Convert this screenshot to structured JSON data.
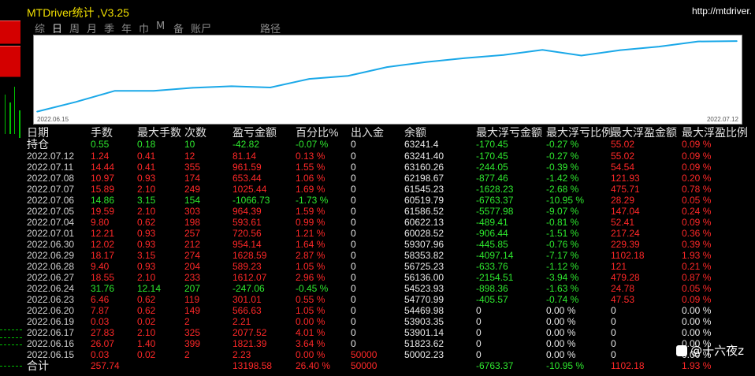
{
  "colors": {
    "red": "#ff2828",
    "green": "#2ee82e",
    "white": "#e8e8e8",
    "yellow": "#f2e000",
    "line": "#1aa8e8"
  },
  "window": {
    "title": "MTDriver统计 ,V3.25",
    "url": "http://mtdriver."
  },
  "tabs": [
    {
      "label": "综",
      "active": false
    },
    {
      "label": "日",
      "active": true
    },
    {
      "label": "周",
      "active": false
    },
    {
      "label": "月",
      "active": false
    },
    {
      "label": "季",
      "active": false
    },
    {
      "label": "年",
      "active": false
    },
    {
      "label": "巾",
      "active": false
    },
    {
      "label": "M",
      "active": false
    },
    {
      "label": "备",
      "active": false
    },
    {
      "label": "账尸",
      "active": false
    },
    {
      "label": "路径",
      "active": false
    }
  ],
  "chart_data": {
    "type": "line",
    "x_start": "2022.06.15",
    "x_end": "2022.07.12",
    "x": [
      "2022.06.15",
      "2022.06.16",
      "2022.06.17",
      "2022.06.19",
      "2022.06.20",
      "2022.06.23",
      "2022.06.24",
      "2022.06.27",
      "2022.06.28",
      "2022.06.29",
      "2022.06.30",
      "2022.07.01",
      "2022.07.04",
      "2022.07.05",
      "2022.07.06",
      "2022.07.07",
      "2022.07.08",
      "2022.07.11",
      "2022.07.12"
    ],
    "values": [
      50002.23,
      51823.62,
      53901.14,
      53903.35,
      54469.98,
      54770.99,
      54523.93,
      56136.0,
      56725.23,
      58353.82,
      59307.96,
      60028.52,
      60622.13,
      61586.52,
      60519.79,
      61545.23,
      62198.67,
      63160.26,
      63241.4
    ],
    "ylim": [
      49500,
      63700
    ]
  },
  "table": {
    "headers": [
      "日期",
      "手数",
      "最大手数",
      "次数",
      "盈亏金额",
      "百分比%",
      "出入金",
      "余额",
      "最大浮亏金额",
      "最大浮亏比例",
      "最大浮盈金额",
      "最大浮盈比例"
    ],
    "rows": [
      {
        "cells": [
          "持仓",
          "0.55",
          "0.18",
          "10",
          "-42.82",
          "-0.07 %",
          "0",
          "63241.4",
          "-170.45",
          "-0.27 %",
          "55.02",
          "0.09 %"
        ],
        "tone": "green",
        "first_tone": "white"
      },
      {
        "cells": [
          "2022.07.12",
          "1.24",
          "0.41",
          "12",
          "81.14",
          "0.13 %",
          "0",
          "63241.40",
          "-170.45",
          "-0.27 %",
          "55.02",
          "0.09 %"
        ],
        "tone": "red"
      },
      {
        "cells": [
          "2022.07.11",
          "14.44",
          "0.41",
          "355",
          "961.59",
          "1.55 %",
          "0",
          "63160.26",
          "-244.05",
          "-0.39 %",
          "54.54",
          "0.09 %"
        ],
        "tone": "red"
      },
      {
        "cells": [
          "2022.07.08",
          "10.97",
          "0.93",
          "174",
          "653.44",
          "1.06 %",
          "0",
          "62198.67",
          "-877.46",
          "-1.42 %",
          "121.93",
          "0.20 %"
        ],
        "tone": "red"
      },
      {
        "cells": [
          "2022.07.07",
          "15.89",
          "2.10",
          "249",
          "1025.44",
          "1.69 %",
          "0",
          "61545.23",
          "-1628.23",
          "-2.68 %",
          "475.71",
          "0.78 %"
        ],
        "tone": "red"
      },
      {
        "cells": [
          "2022.07.06",
          "14.86",
          "3.15",
          "154",
          "-1066.73",
          "-1.73 %",
          "0",
          "60519.79",
          "-6763.37",
          "-10.95 %",
          "28.29",
          "0.05 %"
        ],
        "tone": "green"
      },
      {
        "cells": [
          "2022.07.05",
          "19.59",
          "2.10",
          "303",
          "964.39",
          "1.59 %",
          "0",
          "61586.52",
          "-5577.98",
          "-9.07 %",
          "147.04",
          "0.24 %"
        ],
        "tone": "red"
      },
      {
        "cells": [
          "2022.07.04",
          "9.80",
          "0.62",
          "198",
          "593.61",
          "0.99 %",
          "0",
          "60622.13",
          "-489.41",
          "-0.81 %",
          "52.41",
          "0.09 %"
        ],
        "tone": "red"
      },
      {
        "cells": [
          "2022.07.01",
          "12.21",
          "0.93",
          "257",
          "720.56",
          "1.21 %",
          "0",
          "60028.52",
          "-906.44",
          "-1.51 %",
          "217.24",
          "0.36 %"
        ],
        "tone": "red"
      },
      {
        "cells": [
          "2022.06.30",
          "12.02",
          "0.93",
          "212",
          "954.14",
          "1.64 %",
          "0",
          "59307.96",
          "-445.85",
          "-0.76 %",
          "229.39",
          "0.39 %"
        ],
        "tone": "red"
      },
      {
        "cells": [
          "2022.06.29",
          "18.17",
          "3.15",
          "274",
          "1628.59",
          "2.87 %",
          "0",
          "58353.82",
          "-4097.14",
          "-7.17 %",
          "1102.18",
          "1.93 %"
        ],
        "tone": "red"
      },
      {
        "cells": [
          "2022.06.28",
          "9.40",
          "0.93",
          "204",
          "589.23",
          "1.05 %",
          "0",
          "56725.23",
          "-633.76",
          "-1.12 %",
          "121",
          "0.21 %"
        ],
        "tone": "red"
      },
      {
        "cells": [
          "2022.06.27",
          "18.55",
          "2.10",
          "233",
          "1612.07",
          "2.96 %",
          "0",
          "56136.00",
          "-2154.51",
          "-3.94 %",
          "479.28",
          "0.87 %"
        ],
        "tone": "red"
      },
      {
        "cells": [
          "2022.06.24",
          "31.76",
          "12.14",
          "207",
          "-247.06",
          "-0.45 %",
          "0",
          "54523.93",
          "-898.36",
          "-1.63 %",
          "24.78",
          "0.05 %"
        ],
        "tone": "green"
      },
      {
        "cells": [
          "2022.06.23",
          "6.46",
          "0.62",
          "119",
          "301.01",
          "0.55 %",
          "0",
          "54770.99",
          "-405.57",
          "-0.74 %",
          "47.53",
          "0.09 %"
        ],
        "tone": "red"
      },
      {
        "cells": [
          "2022.06.20",
          "7.87",
          "0.62",
          "149",
          "566.63",
          "1.05 %",
          "0",
          "54469.98",
          "0",
          "0.00 %",
          "0",
          "0.00 %"
        ],
        "tone": "red"
      },
      {
        "cells": [
          "2022.06.19",
          "0.03",
          "0.02",
          "2",
          "2.21",
          "0.00 %",
          "0",
          "53903.35",
          "0",
          "0.00 %",
          "0",
          "0.00 %"
        ],
        "tone": "red"
      },
      {
        "cells": [
          "2022.06.17",
          "27.83",
          "2.10",
          "325",
          "2077.52",
          "4.01 %",
          "0",
          "53901.14",
          "0",
          "0.00 %",
          "0",
          "0.00 %"
        ],
        "tone": "red"
      },
      {
        "cells": [
          "2022.06.16",
          "26.07",
          "1.40",
          "399",
          "1821.39",
          "3.64 %",
          "0",
          "51823.62",
          "0",
          "0.00 %",
          "0",
          "0.00 %"
        ],
        "tone": "red"
      },
      {
        "cells": [
          "2022.06.15",
          "0.03",
          "0.02",
          "2",
          "2.23",
          "0.00 %",
          "50000",
          "50002.23",
          "0",
          "0.00 %",
          "0",
          "0.00 %"
        ],
        "tone": "red"
      },
      {
        "cells": [
          "合计",
          "257.74",
          "",
          "",
          "13198.58",
          "26.40 %",
          "50000",
          "",
          "-6763.37",
          "-10.95 %",
          "1102.18",
          "1.93 %"
        ],
        "tone": "red",
        "first_tone": "white"
      }
    ]
  },
  "watermark": {
    "text": "@十六夜z"
  }
}
